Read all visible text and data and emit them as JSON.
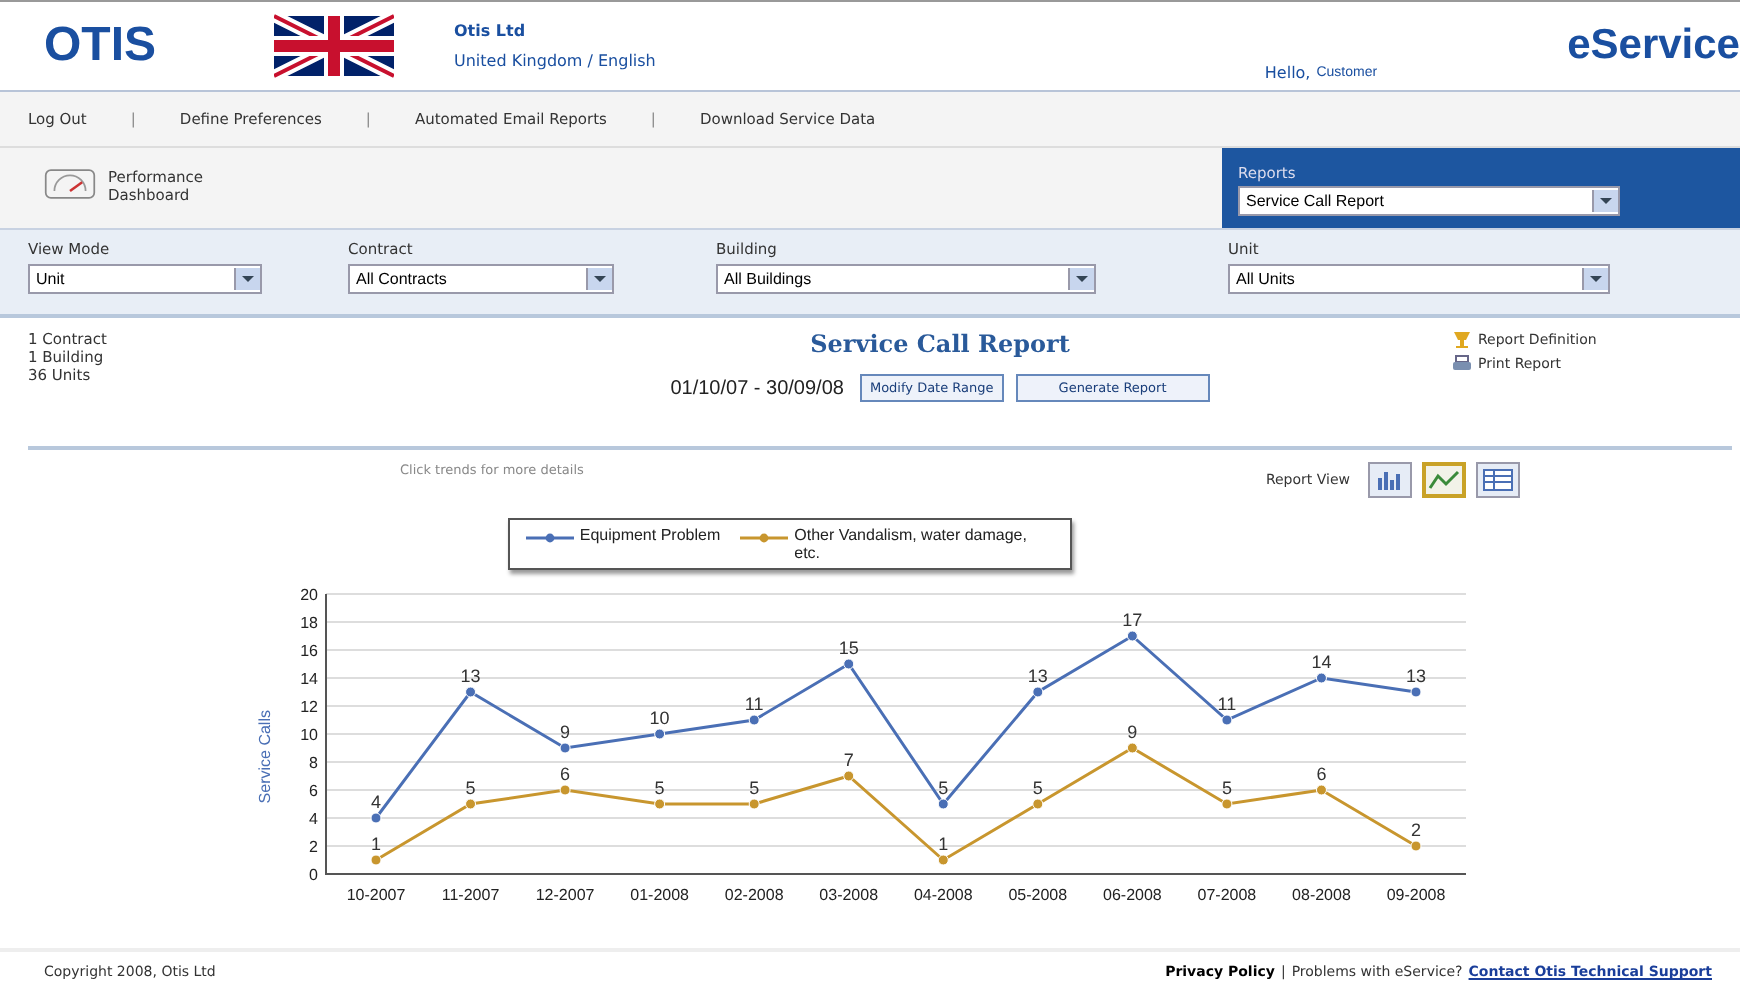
{
  "header": {
    "logo": "OTIS",
    "company": "Otis Ltd",
    "locale": "United Kingdom / English",
    "greeting": "Hello,",
    "user": "Customer",
    "product": "eService"
  },
  "nav": [
    {
      "kind": "link",
      "label": "Log Out"
    },
    {
      "kind": "separator",
      "label": "|"
    },
    {
      "kind": "link",
      "label": "Define Preferences"
    },
    {
      "kind": "separator",
      "label": "|"
    },
    {
      "kind": "link",
      "label": "Automated Email Reports"
    },
    {
      "kind": "separator",
      "label": "|"
    },
    {
      "kind": "link",
      "label": "Download Service Data"
    }
  ],
  "dashboard_link": "Performance Dashboard",
  "reports": {
    "label": "Reports",
    "value": "Service Call Report"
  },
  "filters": [
    {
      "label": "View Mode",
      "value": "Unit"
    },
    {
      "label": "Contract",
      "value": "All Contracts"
    },
    {
      "label": "Building",
      "value": "All Buildings"
    },
    {
      "label": "Unit",
      "value": "All Units"
    }
  ],
  "summary": [
    "1 Contract",
    "1 Building",
    "36 Units"
  ],
  "report_title": "Service Call Report",
  "date_range": "01/10/07 - 30/09/08",
  "buttons": [
    "Modify Date Range",
    "Generate Report"
  ],
  "links": [
    {
      "kind": "definition",
      "label": "Report Definition"
    },
    {
      "kind": "print",
      "label": "Print Report"
    }
  ],
  "hint": "Click trends for more details",
  "report_view": {
    "label": "Report View",
    "options": [
      {
        "kind": "bar",
        "selected": false
      },
      {
        "kind": "line",
        "selected": true
      },
      {
        "kind": "table",
        "selected": false
      }
    ]
  },
  "chart_data": {
    "type": "line",
    "ylabel": "Service Calls",
    "categories": [
      "10-2007",
      "11-2007",
      "12-2007",
      "01-2008",
      "02-2008",
      "03-2008",
      "04-2008",
      "05-2008",
      "06-2008",
      "07-2008",
      "08-2008",
      "09-2008"
    ],
    "ylim": [
      0,
      20
    ],
    "grid": true,
    "yticks": [
      0,
      2,
      4,
      6,
      8,
      10,
      12,
      14,
      16,
      18,
      20
    ],
    "data_labels": true,
    "series": [
      {
        "name": "Equipment Problem",
        "color": "#4a6fb5",
        "marker": "circle",
        "values": [
          4,
          13,
          9,
          10,
          11,
          15,
          5,
          13,
          17,
          11,
          14,
          13
        ]
      },
      {
        "name": "Other Vandalism, water damage, etc.",
        "color": "#c8962e",
        "marker": "circle",
        "values": [
          1,
          5,
          6,
          5,
          5,
          7,
          1,
          5,
          9,
          5,
          6,
          2
        ]
      }
    ]
  },
  "footer": {
    "copyright": "Copyright 2008, Otis Ltd",
    "privacy": "Privacy Policy",
    "separator": "|",
    "problem": "Problems with eService?",
    "support": "Contact Otis Technical Support"
  }
}
